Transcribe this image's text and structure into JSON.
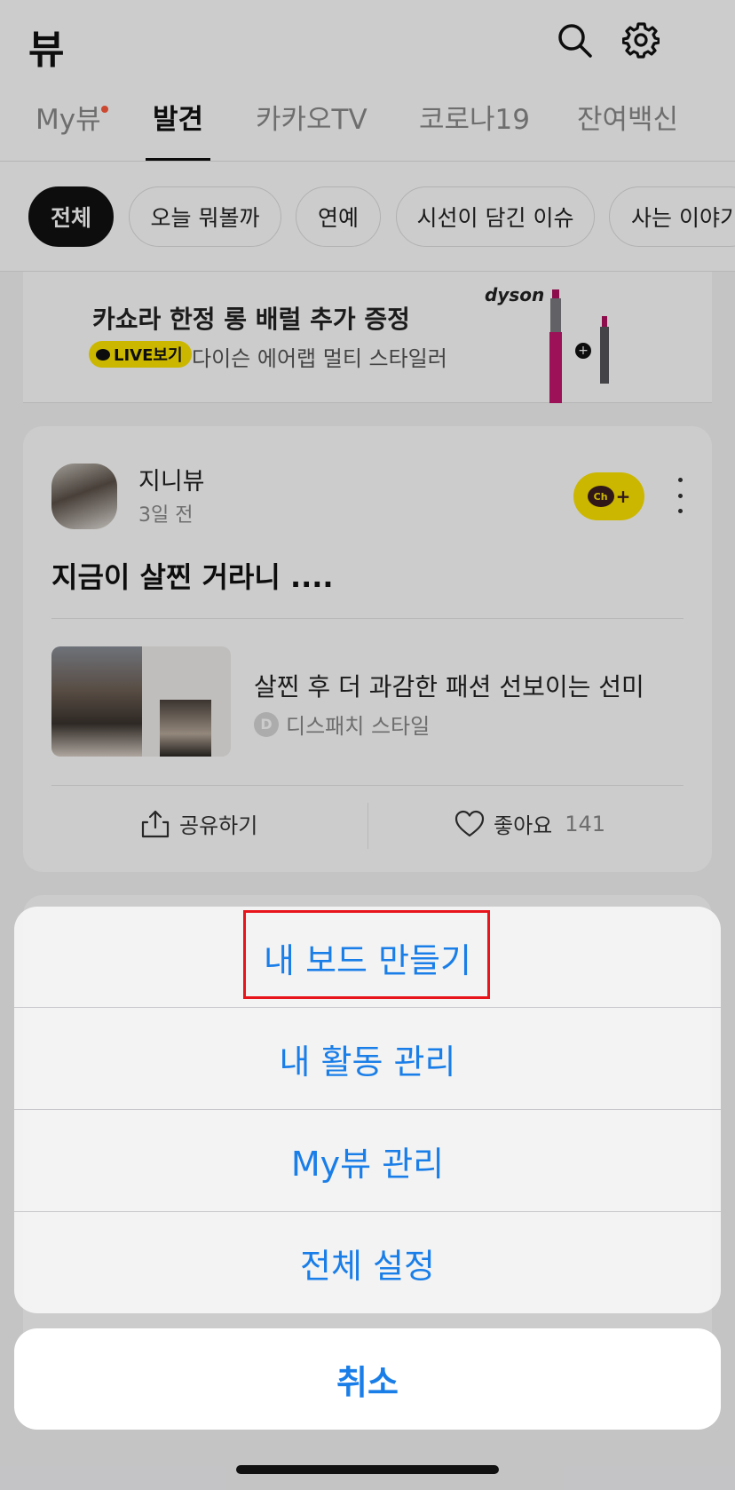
{
  "header": {
    "title": "뷰",
    "icons": [
      "search-icon",
      "gear-icon"
    ]
  },
  "tabs": [
    {
      "label": "My뷰",
      "has_dot": true
    },
    {
      "label": "발견",
      "active": true
    },
    {
      "label": "카카오TV"
    },
    {
      "label": "코로나19"
    },
    {
      "label": "잔여백신"
    }
  ],
  "chips": [
    "전체",
    "오늘 뭐볼까",
    "연예",
    "시선이 담긴 이슈",
    "사는 이야기"
  ],
  "ad": {
    "title": "카쇼라 한정 롱 배럴 추가 증정",
    "live_label": "LIVE보기",
    "description": "다이슨 에어랩 멀티 스타일러",
    "brand": "dyson"
  },
  "post": {
    "author": "지니뷰",
    "time": "3일 전",
    "channel_button": "Ch+",
    "headline": "지금이 살찐 거라니 ....",
    "article_title": "살찐 후 더 과감한 패션 선보이는 선미",
    "source_logo": "D",
    "source": "디스패치 스타일",
    "share_label": "공유하기",
    "like_label": "좋아요",
    "like_count": "141"
  },
  "action_sheet": {
    "items": [
      "내 보드 만들기",
      "내 활동 관리",
      "My뷰 관리",
      "전체 설정"
    ],
    "cancel": "취소",
    "accent_color": "#1a7ee8",
    "highlight_color": "#e8141c"
  }
}
